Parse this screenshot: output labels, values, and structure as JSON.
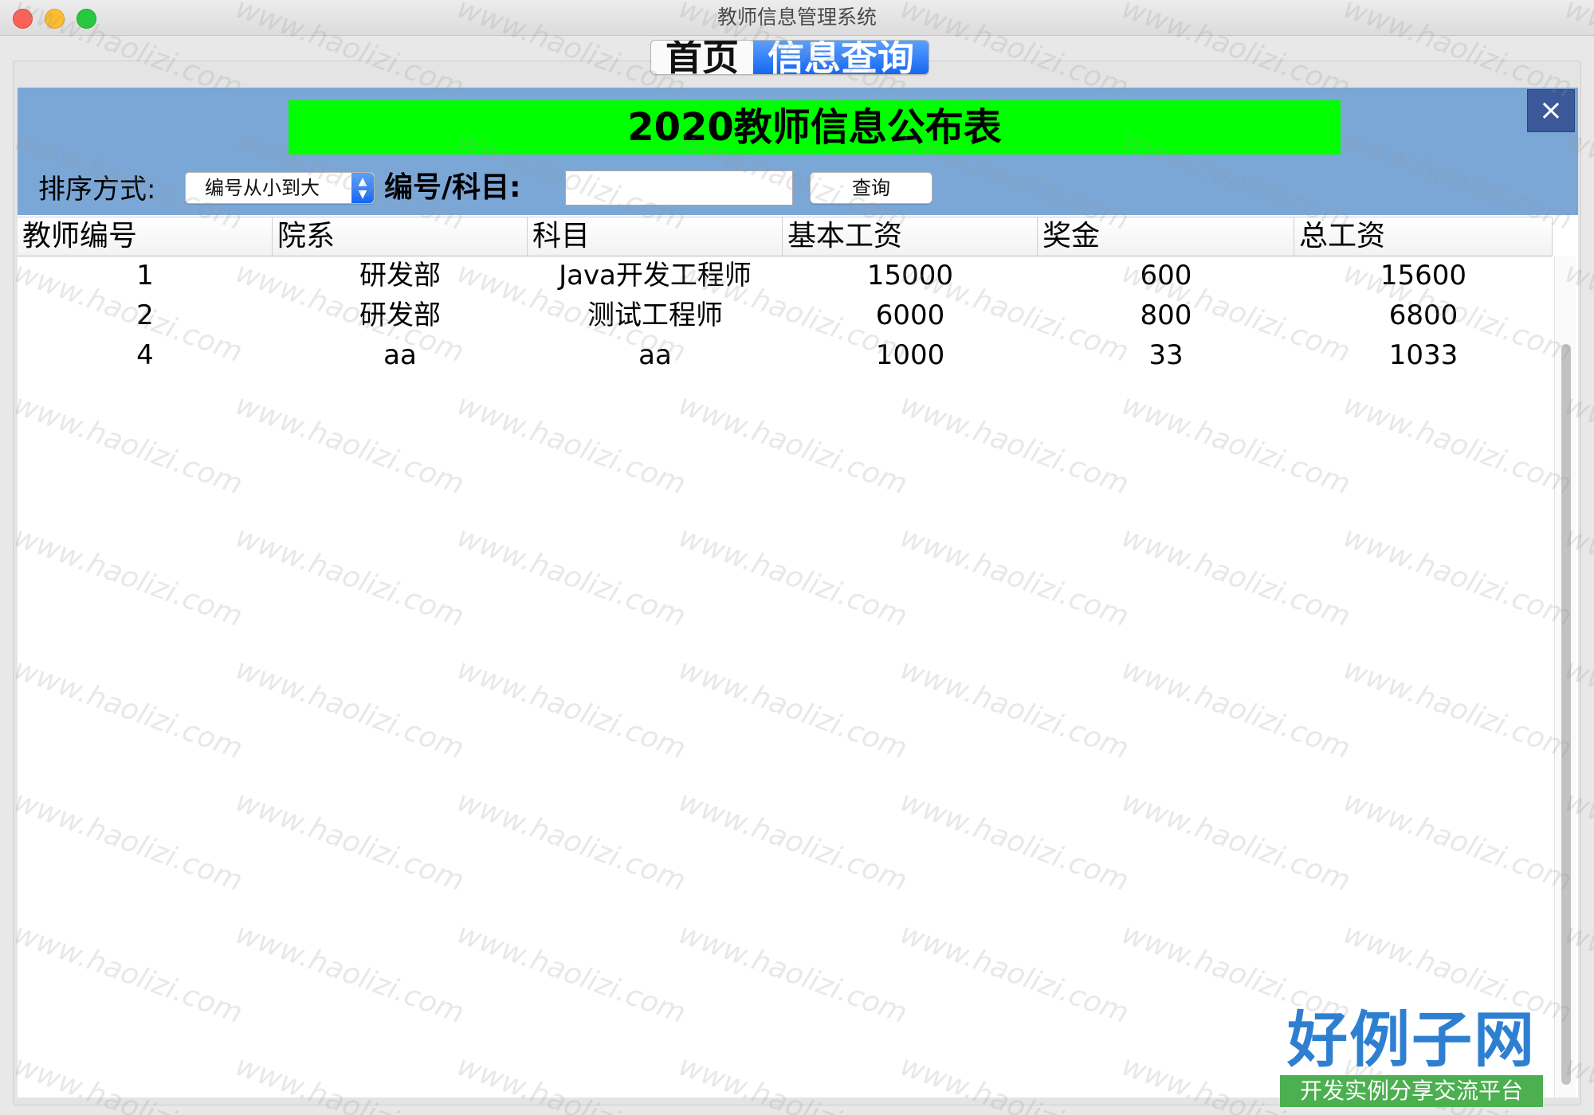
{
  "window": {
    "title": "教师信息管理系统"
  },
  "tabs": [
    {
      "label": "首页",
      "active": false
    },
    {
      "label": "信息查询",
      "active": true
    }
  ],
  "banner": {
    "title": "2020教师信息公布表",
    "color": "#00ff00"
  },
  "close_icon": "×",
  "search": {
    "sort_label": "排序方式:",
    "sort_value": "编号从小到大",
    "id_label": "编号/科目:",
    "input_value": "",
    "query_button": "查询"
  },
  "table": {
    "columns": [
      "教师编号",
      "院系",
      "科目",
      "基本工资",
      "奖金",
      "总工资"
    ],
    "rows": [
      [
        "1",
        "研发部",
        "Java开发工程师",
        "15000",
        "600",
        "15600"
      ],
      [
        "2",
        "研发部",
        "测试工程师",
        "6000",
        "800",
        "6800"
      ],
      [
        "4",
        "aa",
        "aa",
        "1000",
        "33",
        "1033"
      ]
    ]
  },
  "watermark": {
    "text": "www.haolizi.com"
  },
  "logo": {
    "main": "好例子网",
    "sub": "开发实例分享交流平台"
  },
  "colors": {
    "header_bg": "#7ba7d7",
    "tab_active": "#1767f0"
  }
}
